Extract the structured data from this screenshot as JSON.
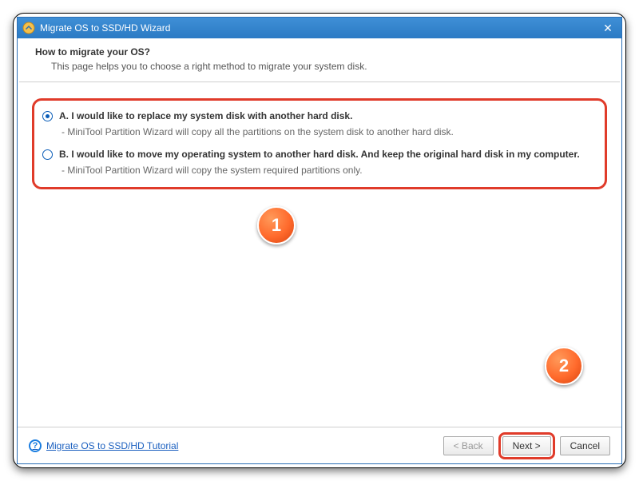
{
  "titlebar": {
    "title": "Migrate OS to SSD/HD Wizard"
  },
  "header": {
    "question": "How to migrate your OS?",
    "subtext": "This page helps you to choose a right method to migrate your system disk."
  },
  "options": {
    "a": {
      "label": "A. I would like to replace my system disk with another hard disk.",
      "desc": "- MiniTool Partition Wizard will copy all the partitions on the system disk to another hard disk.",
      "selected": true
    },
    "b": {
      "label": "B. I would like to move my operating system to another hard disk. And keep the original hard disk in my computer.",
      "desc": "- MiniTool Partition Wizard will copy the system required partitions only.",
      "selected": false
    }
  },
  "callouts": {
    "one": "1",
    "two": "2"
  },
  "footer": {
    "tutorial_link": "Migrate OS to SSD/HD Tutorial",
    "back": "< Back",
    "next": "Next >",
    "cancel": "Cancel"
  }
}
